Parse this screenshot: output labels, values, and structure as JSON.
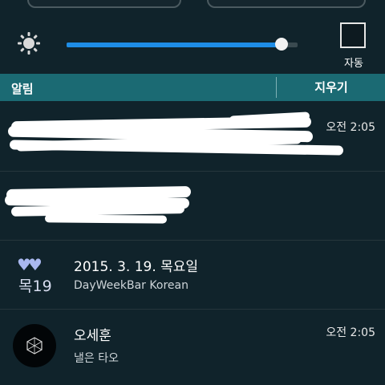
{
  "brightness": {
    "level_percent": 93,
    "auto_label": "자동"
  },
  "notification_panel": {
    "title": "알림",
    "clear_label": "지우기"
  },
  "notifications": [
    {
      "time": "오전 2:05"
    },
    {
      "time": ""
    },
    {
      "title": "2015. 3. 19. 목요일",
      "subtitle": "DayWeekBar Korean",
      "icon_day": "목19",
      "icon": "calendar-hearts-icon"
    },
    {
      "title": "오세훈",
      "subtitle": "낼은 타오",
      "time": "오전 2:05",
      "icon": "avatar"
    }
  ],
  "colors": {
    "accent_blue": "#1e8de6",
    "header_teal": "#1b6a73",
    "background": "#10232b"
  }
}
